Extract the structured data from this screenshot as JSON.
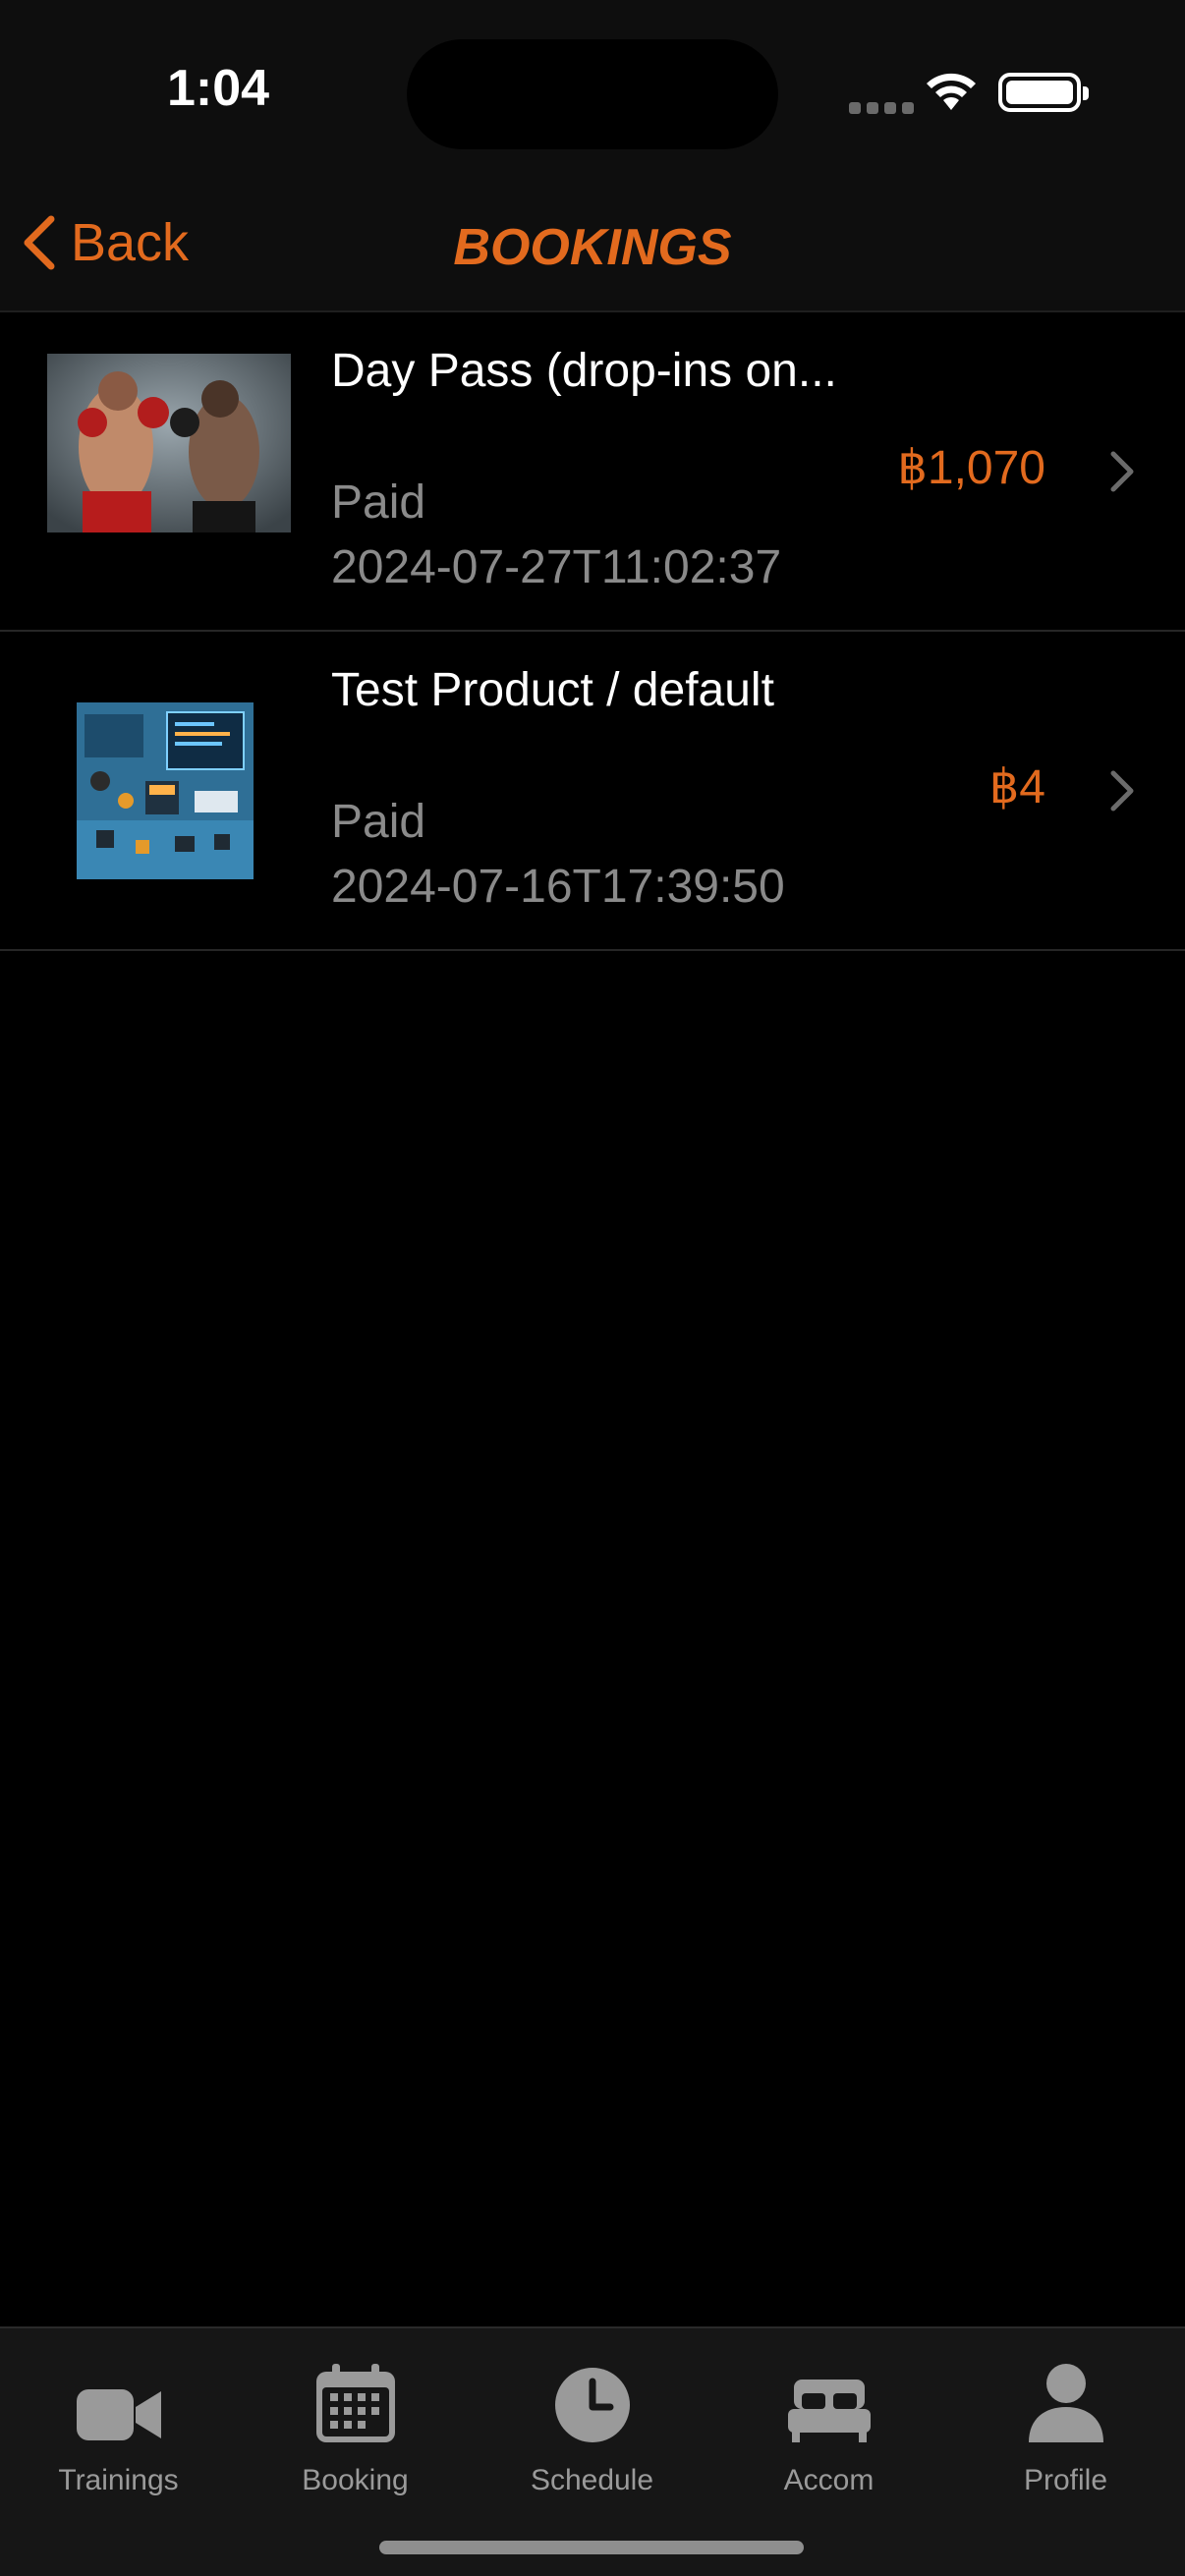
{
  "status_bar": {
    "time": "1:04"
  },
  "nav": {
    "back_label": "Back",
    "title": "BOOKINGS"
  },
  "colors": {
    "accent": "#e26a1e",
    "background": "#000000",
    "secondary_text": "#8a8a8a",
    "tab_inactive": "#9a9a9a"
  },
  "bookings": [
    {
      "title": "Day Pass (drop-ins on...",
      "status": "Paid",
      "date": "2024-07-27T11:02:37",
      "price": "฿1,070",
      "image": "boxers-sparring-photo"
    },
    {
      "title": "Test Product / default",
      "status": "Paid",
      "date": "2024-07-16T17:39:50",
      "price": "฿4",
      "image": "tech-illustration"
    }
  ],
  "tabs": [
    {
      "label": "Trainings",
      "icon": "video-camera-icon"
    },
    {
      "label": "Booking",
      "icon": "calendar-icon"
    },
    {
      "label": "Schedule",
      "icon": "clock-icon"
    },
    {
      "label": "Accom",
      "icon": "bed-icon"
    },
    {
      "label": "Profile",
      "icon": "person-icon"
    }
  ]
}
